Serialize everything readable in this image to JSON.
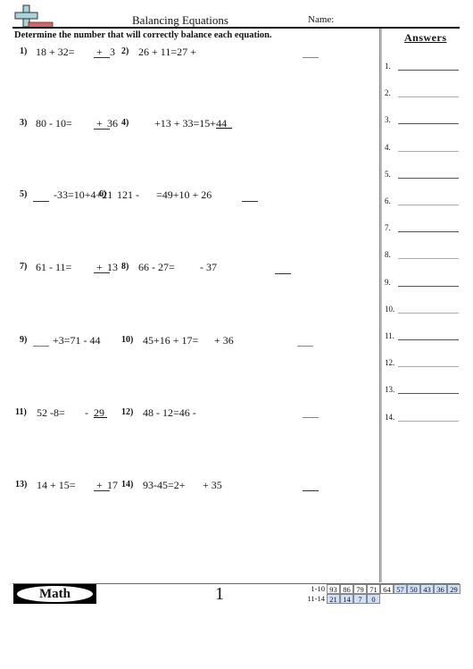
{
  "header": {
    "title": "Balancing Equations",
    "name_label": "Name:",
    "instructions": "Determine the number that will correctly balance each equation."
  },
  "answers": {
    "title": "Answers",
    "labels": [
      "1.",
      "2.",
      "3.",
      "4.",
      "5.",
      "6.",
      "7.",
      "8.",
      "9.",
      "10.",
      "11.",
      "12.",
      "13.",
      "14."
    ]
  },
  "problems": [
    {
      "num": "1)",
      "left": "18  +  32=",
      "blank_text": "+",
      "right": "3"
    },
    {
      "num": "2)",
      "text": "26  +  11=27  +"
    },
    {
      "num": "3)",
      "left": "80  -  10=",
      "blank_text": "+",
      "right": "36"
    },
    {
      "num": "4)",
      "text": "+13 + 33=15+",
      "underlined": "44"
    },
    {
      "num": "5)",
      "text": "-33=10+4+21"
    },
    {
      "num": "6)",
      "text": "121  -",
      "right": "=49+10 + 26"
    },
    {
      "num": "7)",
      "left": "61  -  11=",
      "blank_text": "+",
      "right": "13"
    },
    {
      "num": "8)",
      "text": "66  -  27=",
      "right": "-  37"
    },
    {
      "num": "9)",
      "text": "+3=71  -  44"
    },
    {
      "num": "10)",
      "text": "45+16 + 17=",
      "right": "+  36"
    },
    {
      "num": "11)",
      "left": "52  -8=",
      "right_pre": "-",
      "underlined": "29"
    },
    {
      "num": "12)",
      "text": "48  -  12=46  -"
    },
    {
      "num": "13)",
      "left": "14  +  15=",
      "blank_text": "+",
      "right": "17"
    },
    {
      "num": "14)",
      "text": "93-45=2+",
      "right": "+ 35"
    }
  ],
  "footer": {
    "badge": "Math",
    "page_number": "1",
    "score_rows": [
      {
        "label": "1-10",
        "cells": [
          "93",
          "86",
          "79",
          "71",
          "64",
          "57",
          "50",
          "43",
          "36",
          "29"
        ]
      },
      {
        "label": "11-14",
        "cells": [
          "21",
          "14",
          "7",
          "0"
        ]
      }
    ]
  }
}
